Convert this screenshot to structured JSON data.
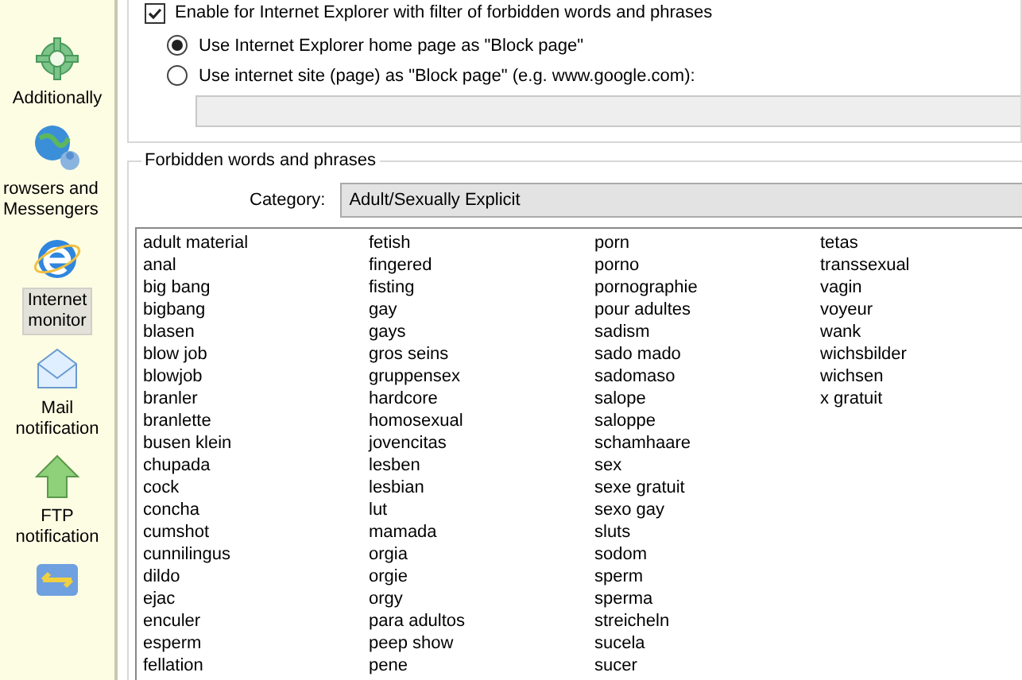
{
  "sidebar": {
    "items": [
      {
        "kind": "gear",
        "label": "Additionally",
        "selected": false
      },
      {
        "kind": "globe",
        "label": "rowsers and Messengers",
        "selected": false
      },
      {
        "kind": "ie",
        "label": "Internet monitor",
        "selected": true
      },
      {
        "kind": "mail",
        "label": "Mail notification",
        "selected": false
      },
      {
        "kind": "ftp",
        "label": "FTP notification",
        "selected": false
      },
      {
        "kind": "transfer",
        "selected": false
      }
    ]
  },
  "browser_filter": {
    "checked": true,
    "checkbox_label": "Enable for Internet Explorer with filter of forbidden words and phrases",
    "options": [
      {
        "label": "Use Internet Explorer home page as \"Block page\"",
        "selected": true
      },
      {
        "label": "Use internet site (page) as \"Block page\" (e.g. www.google.com):",
        "selected": false
      }
    ]
  },
  "forbidden_words": {
    "title": "Forbidden words and phrases",
    "category_label": "Category:",
    "category": "Adult/Sexually Explicit",
    "words": [
      "adult material",
      "anal",
      "big bang",
      "bigbang",
      "blasen",
      "blow job",
      "blowjob",
      "branler",
      "branlette",
      "busen klein",
      "chupada",
      "cock",
      "concha",
      "cumshot",
      "cunnilingus",
      "dildo",
      "ejac",
      "enculer",
      "esperm",
      "fellation",
      "fetish",
      "fingered",
      "fisting",
      "gay",
      "gays",
      "gros seins",
      "gruppensex",
      "hardcore",
      "homosexual",
      "jovencitas",
      "lesben",
      "lesbian",
      "lut",
      "mamada",
      "orgia",
      "orgie",
      "orgy",
      "para adultos",
      "peep show",
      "pene",
      "porn",
      "porno",
      "pornographie",
      "pour adultes",
      "sadism",
      "sado mado",
      "sadomaso",
      "salope",
      "saloppe",
      "schamhaare",
      "sex",
      "sexe gratuit",
      "sexo gay",
      "sluts",
      "sodom",
      "sperm",
      "sperma",
      "streicheln",
      "sucela",
      "sucer",
      "tetas",
      "transsexual",
      "vagin",
      "voyeur",
      "wank",
      "wichsbilder",
      "wichsen",
      "x gratuit"
    ]
  }
}
